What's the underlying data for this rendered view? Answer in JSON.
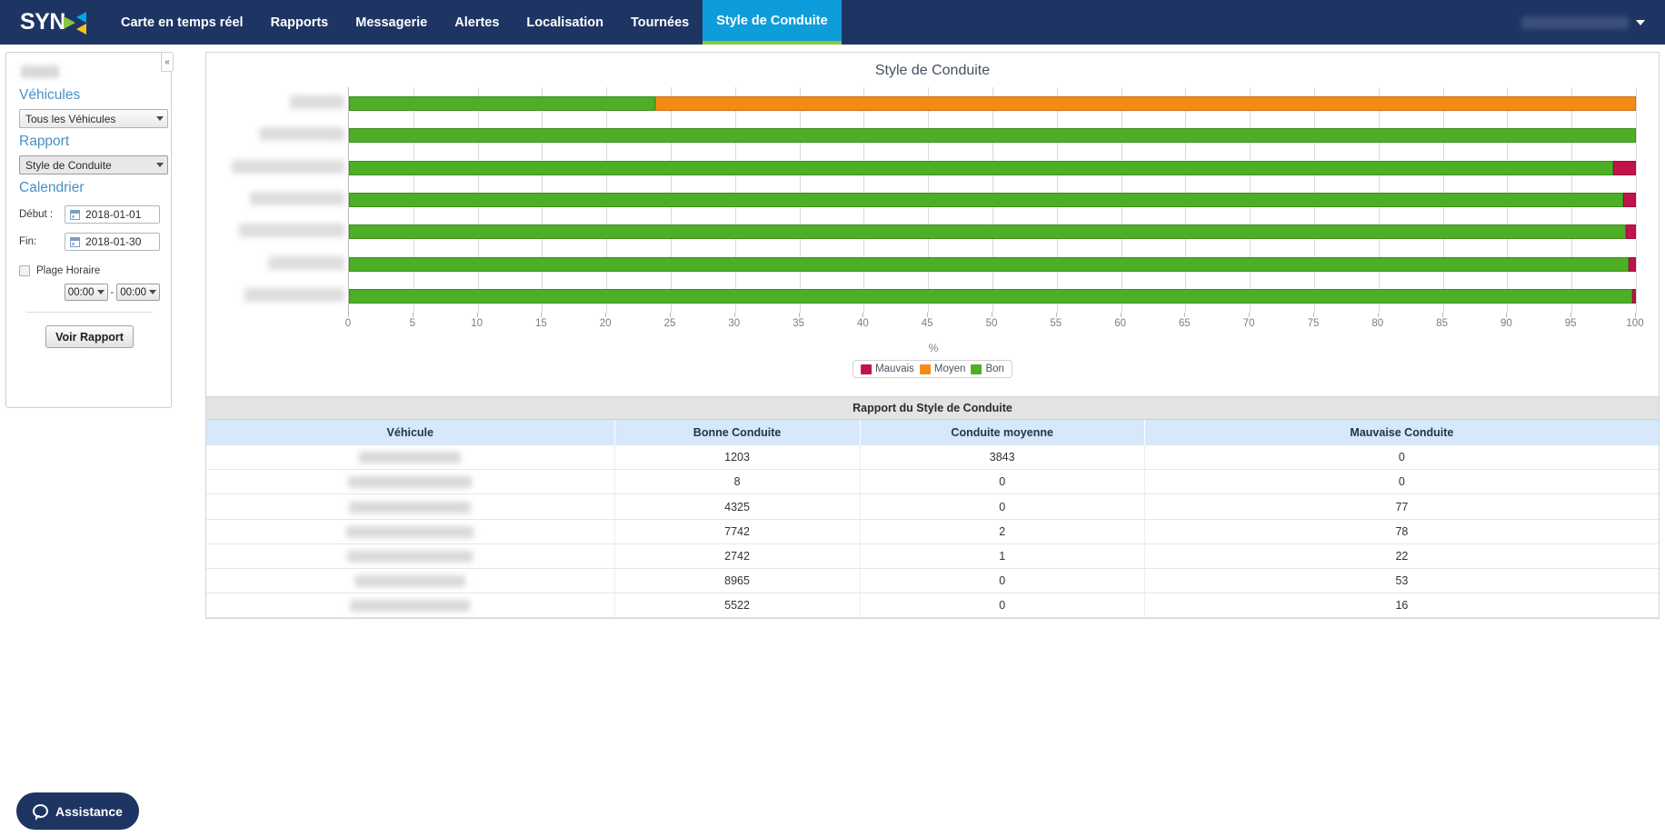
{
  "topnav": {
    "logo_text": "SYN",
    "logo_name": "synx-logo",
    "items": [
      {
        "label": "Carte en temps réel",
        "active": false
      },
      {
        "label": "Rapports",
        "active": false
      },
      {
        "label": "Messagerie",
        "active": false
      },
      {
        "label": "Alertes",
        "active": false
      },
      {
        "label": "Localisation",
        "active": false
      },
      {
        "label": "Tournées",
        "active": false
      },
      {
        "label": "Style de Conduite",
        "active": true
      }
    ],
    "user_menu_label": ""
  },
  "sidebar": {
    "collapse_icon": "«",
    "vehicles_heading": "Véhicules",
    "vehicles_selected": "Tous les Véhicules",
    "report_heading": "Rapport",
    "report_selected": "Style de Conduite",
    "calendar_heading": "Calendrier",
    "start_label": "Début :",
    "start_value": "2018-01-01",
    "end_label": "Fin:",
    "end_value": "2018-01-30",
    "time_range_label": "Plage Horaire",
    "time_from": "00:00",
    "time_to": "00:00",
    "time_separator": "-",
    "submit_label": "Voir Rapport"
  },
  "chart_data": {
    "type": "bar",
    "orientation": "horizontal",
    "stacked": true,
    "stack_mode": "percent",
    "title": "Style de Conduite",
    "xlabel": "%",
    "ylabel": "",
    "xlim": [
      0,
      100
    ],
    "xticks": [
      0,
      5,
      10,
      15,
      20,
      25,
      30,
      35,
      40,
      45,
      50,
      55,
      60,
      65,
      70,
      75,
      80,
      85,
      90,
      95,
      100
    ],
    "xticklabels": [
      "0",
      "5",
      "10",
      "15",
      "20",
      "25",
      "30",
      "35",
      "40",
      "45",
      "50",
      "55",
      "60",
      "65",
      "70",
      "75",
      "80",
      "85",
      "90",
      "95",
      "100"
    ],
    "grid": true,
    "legend_position": "bottom",
    "categories": [
      "",
      "",
      "",
      "",
      "",
      "",
      ""
    ],
    "series": [
      {
        "name": "Bon",
        "color": "#4caf26",
        "values": [
          23.8,
          100.0,
          98.25,
          99.0,
          99.2,
          99.41,
          99.71
        ]
      },
      {
        "name": "Moyen",
        "color": "#f68a16",
        "values": [
          76.2,
          0.0,
          0.0,
          0.03,
          0.04,
          0.0,
          0.0
        ]
      },
      {
        "name": "Mauvais",
        "color": "#c2134b",
        "values": [
          0.0,
          0.0,
          1.75,
          0.97,
          0.76,
          0.59,
          0.29
        ]
      }
    ],
    "legend": [
      {
        "label": "Mauvais",
        "color": "#c2134b"
      },
      {
        "label": "Moyen",
        "color": "#f68a16"
      },
      {
        "label": "Bon",
        "color": "#4caf26"
      }
    ]
  },
  "table": {
    "caption": "Rapport du Style de Conduite",
    "columns": [
      "Véhicule",
      "Bonne Conduite",
      "Conduite moyenne",
      "Mauvaise Conduite"
    ],
    "rows": [
      {
        "vehicule": "",
        "bonne": "1203",
        "moyenne": "3843",
        "mauvaise": "0"
      },
      {
        "vehicule": "",
        "bonne": "8",
        "moyenne": "0",
        "mauvaise": "0"
      },
      {
        "vehicule": "",
        "bonne": "4325",
        "moyenne": "0",
        "mauvaise": "77"
      },
      {
        "vehicule": "",
        "bonne": "7742",
        "moyenne": "2",
        "mauvaise": "78"
      },
      {
        "vehicule": "",
        "bonne": "2742",
        "moyenne": "1",
        "mauvaise": "22"
      },
      {
        "vehicule": "",
        "bonne": "8965",
        "moyenne": "0",
        "mauvaise": "53"
      },
      {
        "vehicule": "",
        "bonne": "5522",
        "moyenne": "0",
        "mauvaise": "16"
      }
    ]
  },
  "assistance": {
    "label": "Assistance"
  },
  "colors": {
    "nav_bg": "#1e3564",
    "nav_active": "#0d9ddb",
    "nav_active_underline": "#8cc63f",
    "heading_blue": "#4a90c4",
    "bon": "#4caf26",
    "moyen": "#f68a16",
    "mauvais": "#c2134b",
    "table_header": "#d6e8fa"
  }
}
